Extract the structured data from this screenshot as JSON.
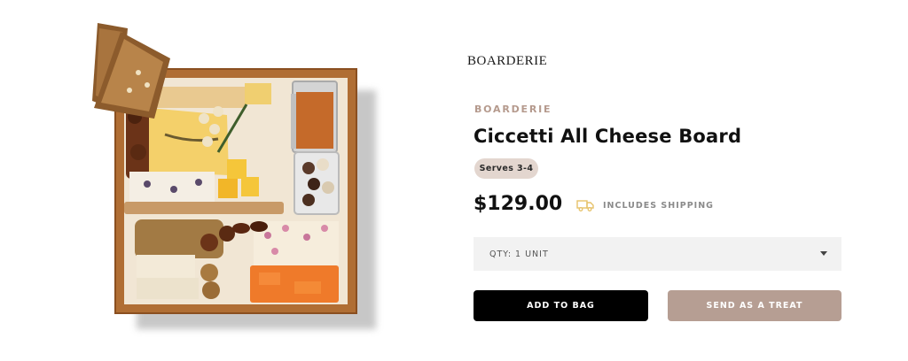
{
  "brand": {
    "logo_text": "BOARDERIE",
    "label": "BOARDERIE"
  },
  "product": {
    "title": "Ciccetti All Cheese Board",
    "badge": "Serves 3-4",
    "price": "$129.00",
    "shipping_note": "INCLUDES SHIPPING",
    "shipping_icon": "truck-icon",
    "image_alt": "charcuterie-board-photo"
  },
  "quantity": {
    "selected": "QTY: 1 UNIT",
    "icon": "chevron-down-icon"
  },
  "actions": {
    "add_to_bag": "ADD TO BAG",
    "send_as_treat": "SEND AS A TREAT"
  },
  "colors": {
    "accent": "#b69e93",
    "badge_bg": "#e3d6cf",
    "brand_label": "#b59a8d",
    "primary_button": "#000000",
    "select_bg": "#f2f2f2",
    "shipping_icon": "#e6c26a"
  }
}
